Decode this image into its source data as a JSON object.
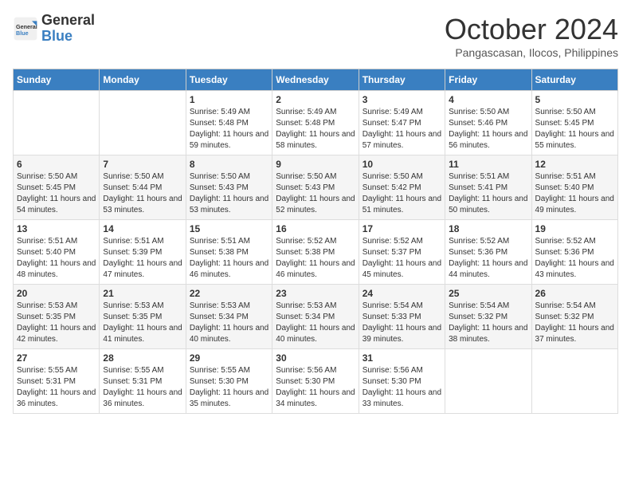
{
  "header": {
    "logo_general": "General",
    "logo_blue": "Blue",
    "month_title": "October 2024",
    "subtitle": "Pangascasan, Ilocos, Philippines"
  },
  "columns": [
    "Sunday",
    "Monday",
    "Tuesday",
    "Wednesday",
    "Thursday",
    "Friday",
    "Saturday"
  ],
  "weeks": [
    [
      {
        "day": "",
        "info": ""
      },
      {
        "day": "",
        "info": ""
      },
      {
        "day": "1",
        "info": "Sunrise: 5:49 AM\nSunset: 5:48 PM\nDaylight: 11 hours and 59 minutes."
      },
      {
        "day": "2",
        "info": "Sunrise: 5:49 AM\nSunset: 5:48 PM\nDaylight: 11 hours and 58 minutes."
      },
      {
        "day": "3",
        "info": "Sunrise: 5:49 AM\nSunset: 5:47 PM\nDaylight: 11 hours and 57 minutes."
      },
      {
        "day": "4",
        "info": "Sunrise: 5:50 AM\nSunset: 5:46 PM\nDaylight: 11 hours and 56 minutes."
      },
      {
        "day": "5",
        "info": "Sunrise: 5:50 AM\nSunset: 5:45 PM\nDaylight: 11 hours and 55 minutes."
      }
    ],
    [
      {
        "day": "6",
        "info": "Sunrise: 5:50 AM\nSunset: 5:45 PM\nDaylight: 11 hours and 54 minutes."
      },
      {
        "day": "7",
        "info": "Sunrise: 5:50 AM\nSunset: 5:44 PM\nDaylight: 11 hours and 53 minutes."
      },
      {
        "day": "8",
        "info": "Sunrise: 5:50 AM\nSunset: 5:43 PM\nDaylight: 11 hours and 53 minutes."
      },
      {
        "day": "9",
        "info": "Sunrise: 5:50 AM\nSunset: 5:43 PM\nDaylight: 11 hours and 52 minutes."
      },
      {
        "day": "10",
        "info": "Sunrise: 5:50 AM\nSunset: 5:42 PM\nDaylight: 11 hours and 51 minutes."
      },
      {
        "day": "11",
        "info": "Sunrise: 5:51 AM\nSunset: 5:41 PM\nDaylight: 11 hours and 50 minutes."
      },
      {
        "day": "12",
        "info": "Sunrise: 5:51 AM\nSunset: 5:40 PM\nDaylight: 11 hours and 49 minutes."
      }
    ],
    [
      {
        "day": "13",
        "info": "Sunrise: 5:51 AM\nSunset: 5:40 PM\nDaylight: 11 hours and 48 minutes."
      },
      {
        "day": "14",
        "info": "Sunrise: 5:51 AM\nSunset: 5:39 PM\nDaylight: 11 hours and 47 minutes."
      },
      {
        "day": "15",
        "info": "Sunrise: 5:51 AM\nSunset: 5:38 PM\nDaylight: 11 hours and 46 minutes."
      },
      {
        "day": "16",
        "info": "Sunrise: 5:52 AM\nSunset: 5:38 PM\nDaylight: 11 hours and 46 minutes."
      },
      {
        "day": "17",
        "info": "Sunrise: 5:52 AM\nSunset: 5:37 PM\nDaylight: 11 hours and 45 minutes."
      },
      {
        "day": "18",
        "info": "Sunrise: 5:52 AM\nSunset: 5:36 PM\nDaylight: 11 hours and 44 minutes."
      },
      {
        "day": "19",
        "info": "Sunrise: 5:52 AM\nSunset: 5:36 PM\nDaylight: 11 hours and 43 minutes."
      }
    ],
    [
      {
        "day": "20",
        "info": "Sunrise: 5:53 AM\nSunset: 5:35 PM\nDaylight: 11 hours and 42 minutes."
      },
      {
        "day": "21",
        "info": "Sunrise: 5:53 AM\nSunset: 5:35 PM\nDaylight: 11 hours and 41 minutes."
      },
      {
        "day": "22",
        "info": "Sunrise: 5:53 AM\nSunset: 5:34 PM\nDaylight: 11 hours and 40 minutes."
      },
      {
        "day": "23",
        "info": "Sunrise: 5:53 AM\nSunset: 5:34 PM\nDaylight: 11 hours and 40 minutes."
      },
      {
        "day": "24",
        "info": "Sunrise: 5:54 AM\nSunset: 5:33 PM\nDaylight: 11 hours and 39 minutes."
      },
      {
        "day": "25",
        "info": "Sunrise: 5:54 AM\nSunset: 5:32 PM\nDaylight: 11 hours and 38 minutes."
      },
      {
        "day": "26",
        "info": "Sunrise: 5:54 AM\nSunset: 5:32 PM\nDaylight: 11 hours and 37 minutes."
      }
    ],
    [
      {
        "day": "27",
        "info": "Sunrise: 5:55 AM\nSunset: 5:31 PM\nDaylight: 11 hours and 36 minutes."
      },
      {
        "day": "28",
        "info": "Sunrise: 5:55 AM\nSunset: 5:31 PM\nDaylight: 11 hours and 36 minutes."
      },
      {
        "day": "29",
        "info": "Sunrise: 5:55 AM\nSunset: 5:30 PM\nDaylight: 11 hours and 35 minutes."
      },
      {
        "day": "30",
        "info": "Sunrise: 5:56 AM\nSunset: 5:30 PM\nDaylight: 11 hours and 34 minutes."
      },
      {
        "day": "31",
        "info": "Sunrise: 5:56 AM\nSunset: 5:30 PM\nDaylight: 11 hours and 33 minutes."
      },
      {
        "day": "",
        "info": ""
      },
      {
        "day": "",
        "info": ""
      }
    ]
  ]
}
